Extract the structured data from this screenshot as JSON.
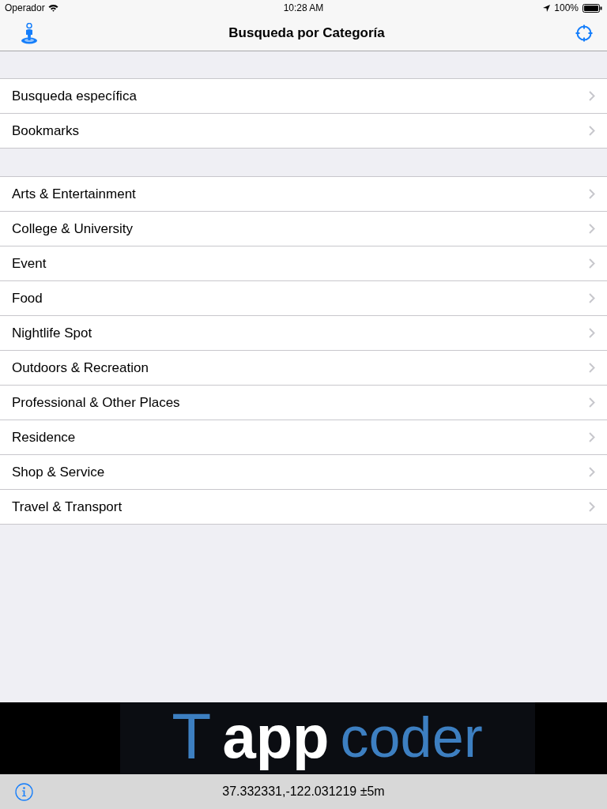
{
  "status_bar": {
    "carrier": "Operador",
    "time": "10:28 AM",
    "battery": "100%"
  },
  "nav_bar": {
    "title": "Busqueda por Categoría"
  },
  "sections": [
    {
      "rows": [
        {
          "label": "Busqueda específica"
        },
        {
          "label": "Bookmarks"
        }
      ]
    },
    {
      "rows": [
        {
          "label": "Arts & Entertainment"
        },
        {
          "label": "College & University"
        },
        {
          "label": "Event"
        },
        {
          "label": "Food"
        },
        {
          "label": "Nightlife Spot"
        },
        {
          "label": "Outdoors & Recreation"
        },
        {
          "label": "Professional & Other Places"
        },
        {
          "label": "Residence"
        },
        {
          "label": "Shop & Service"
        },
        {
          "label": "Travel & Transport"
        }
      ]
    }
  ],
  "banner": {
    "words": [
      {
        "text": "T",
        "kind": "thin"
      },
      {
        "text": "app",
        "kind": "bold"
      },
      {
        "text": "coder",
        "kind": "light"
      }
    ]
  },
  "toolbar": {
    "coordinates": "37.332331,-122.031219 ±5m"
  }
}
